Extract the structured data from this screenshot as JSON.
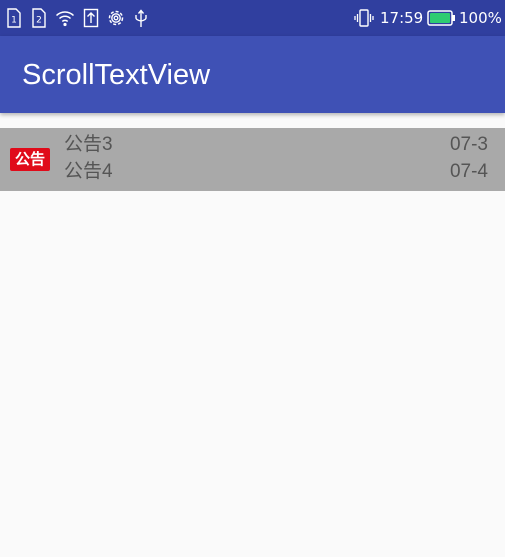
{
  "status_bar": {
    "sim1_label": "1",
    "sim2_label": "2",
    "time": "17:59",
    "battery": "100%",
    "icons": [
      "sim1-icon",
      "sim2-icon",
      "wifi-icon",
      "upload-icon",
      "settings-icon",
      "usb-icon",
      "vibrate-icon",
      "battery-icon"
    ],
    "battery_color": "#2ecc71"
  },
  "app_bar": {
    "title": "ScrollTextView",
    "color": "#3f51b5"
  },
  "notice": {
    "badge": "公告",
    "badge_color": "#e00b1a",
    "items": [
      {
        "title": "公告3",
        "date": "07-3"
      },
      {
        "title": "公告4",
        "date": "07-4"
      }
    ]
  }
}
